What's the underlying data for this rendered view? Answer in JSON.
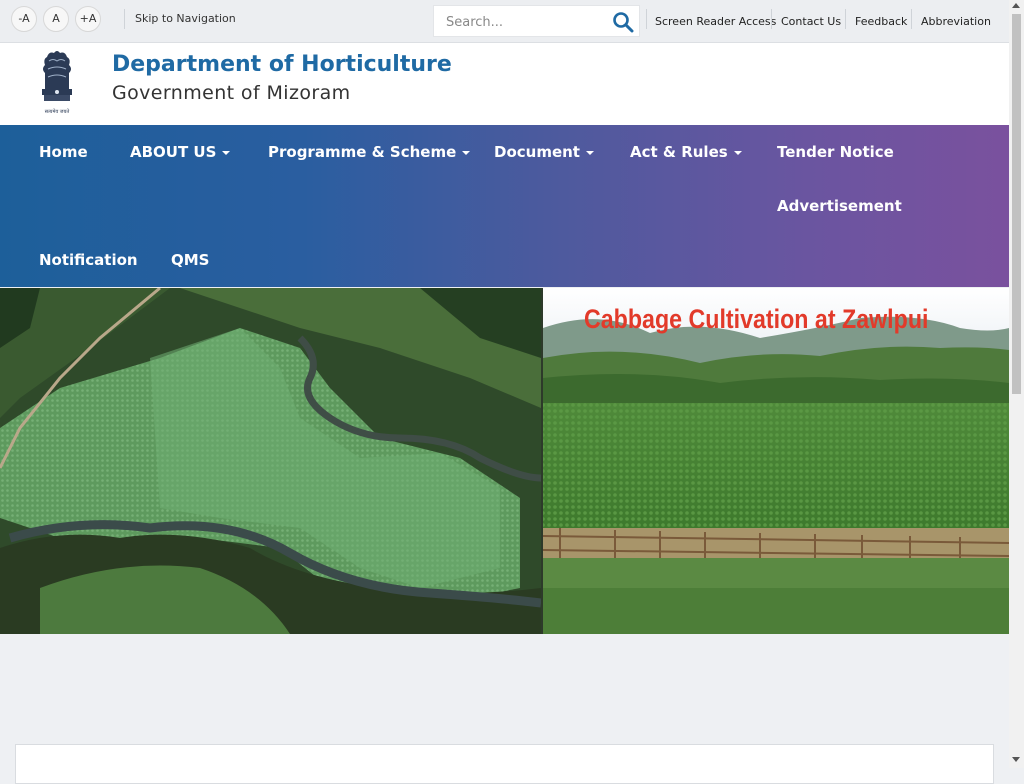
{
  "topbar": {
    "font_decrease": "-A",
    "font_normal": "A",
    "font_increase": "+A",
    "skip_link": "Skip to Navigation",
    "search_placeholder": "Search...",
    "links": [
      "Screen Reader Access",
      "Contact Us",
      "Feedback",
      "Abbreviation"
    ]
  },
  "header": {
    "title": "Department of Horticulture",
    "subtitle": "Government of Mizoram",
    "emblem_motto": "सत्यमेव जयते"
  },
  "nav": {
    "items": [
      {
        "label": "Home",
        "has_dropdown": false
      },
      {
        "label": "ABOUT US",
        "has_dropdown": true
      },
      {
        "label": "Programme & Scheme",
        "has_dropdown": true
      },
      {
        "label": "Document",
        "has_dropdown": true
      },
      {
        "label": "Act & Rules",
        "has_dropdown": true
      },
      {
        "label": "Tender Notice",
        "has_dropdown": false
      },
      {
        "label": "Advertisement",
        "has_dropdown": false
      },
      {
        "label": "Notification",
        "has_dropdown": false
      },
      {
        "label": "QMS",
        "has_dropdown": false
      }
    ]
  },
  "banner": {
    "caption": "Cabbage Cultivation at Zawlpui"
  },
  "colors": {
    "title_blue": "#1f6aa4",
    "nav_gradient_start": "#1d5f9a",
    "nav_gradient_end": "#7a519e",
    "caption_red": "#e23a2a"
  },
  "icons": {
    "search": "search-icon",
    "emblem": "national-emblem-icon",
    "dropdown": "caret-down-icon"
  }
}
